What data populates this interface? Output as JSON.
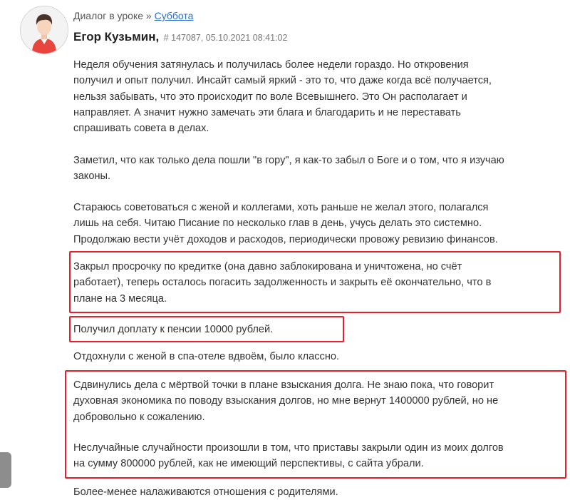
{
  "header": {
    "breadcrumb_prefix": "Диалог в уроке »",
    "breadcrumb_link": "Суббота",
    "author_name": "Егор Кузьмин,",
    "meta": "# 147087, 05.10.2021 08:41:02"
  },
  "post": {
    "p1": [
      "Неделя обучения затянулась и получилась более недели гораздо. Но откровения",
      "получил и опыт получил. Инсайт самый яркий  - это то, что даже когда всё получается,",
      "нельзя забывать, что это происходит по воле Всевышнего. Это Он располагает и",
      "направляет. А значит нужно замечать эти блага и благодарить и не переставать",
      "спрашивать совета в делах."
    ],
    "p2": [
      "Заметил, что как только дела пошли \"в гору\", я как-то забыл о Боге и о том, что я изучаю",
      "законы."
    ],
    "p3": [
      "Стараюсь советоваться с женой и коллегами, хоть раньше не желал этого, полагался",
      "лишь на себя. Читаю Писание по несколько глав в день, учусь делать это системно.",
      "Продолжаю вести учёт доходов и расходов, периодически провожу ревизию финансов."
    ],
    "p4": [
      " Закрыл просрочку по кредитке (она давно заблокирована и уничтожена, но счёт",
      "работает), теперь осталось погасить задолженность и закрыть её окончательно, что в",
      "плане на 3 месяца."
    ],
    "p5": [
      "Получил доплату к пенсии 10000 рублей."
    ],
    "p6": [
      "Отдохнули с женой в спа-отеле вдвоём, было классно."
    ],
    "p7": [
      "Сдвинулись дела с мёртвой точки в плане взыскания долга. Не знаю пока, что говорит",
      "духовная экономика по поводу взыскания долгов, но мне вернут 1400000 рублей, но не",
      "добровольно к сожалению."
    ],
    "p8": [
      "Неслучайные случайности произошли в том, что приставы закрыли один из моих долгов",
      "на сумму 800000 рублей, как не имеющий перспективы, с сайта убрали."
    ],
    "p9": [
      "Более-менее налаживаются отношения с родителями."
    ]
  },
  "colors": {
    "highlight_border": "#e5202a",
    "link": "#2a6fcf",
    "avatar_accent": "#e8453c"
  },
  "icons": {
    "avatar": "user-avatar-icon"
  }
}
